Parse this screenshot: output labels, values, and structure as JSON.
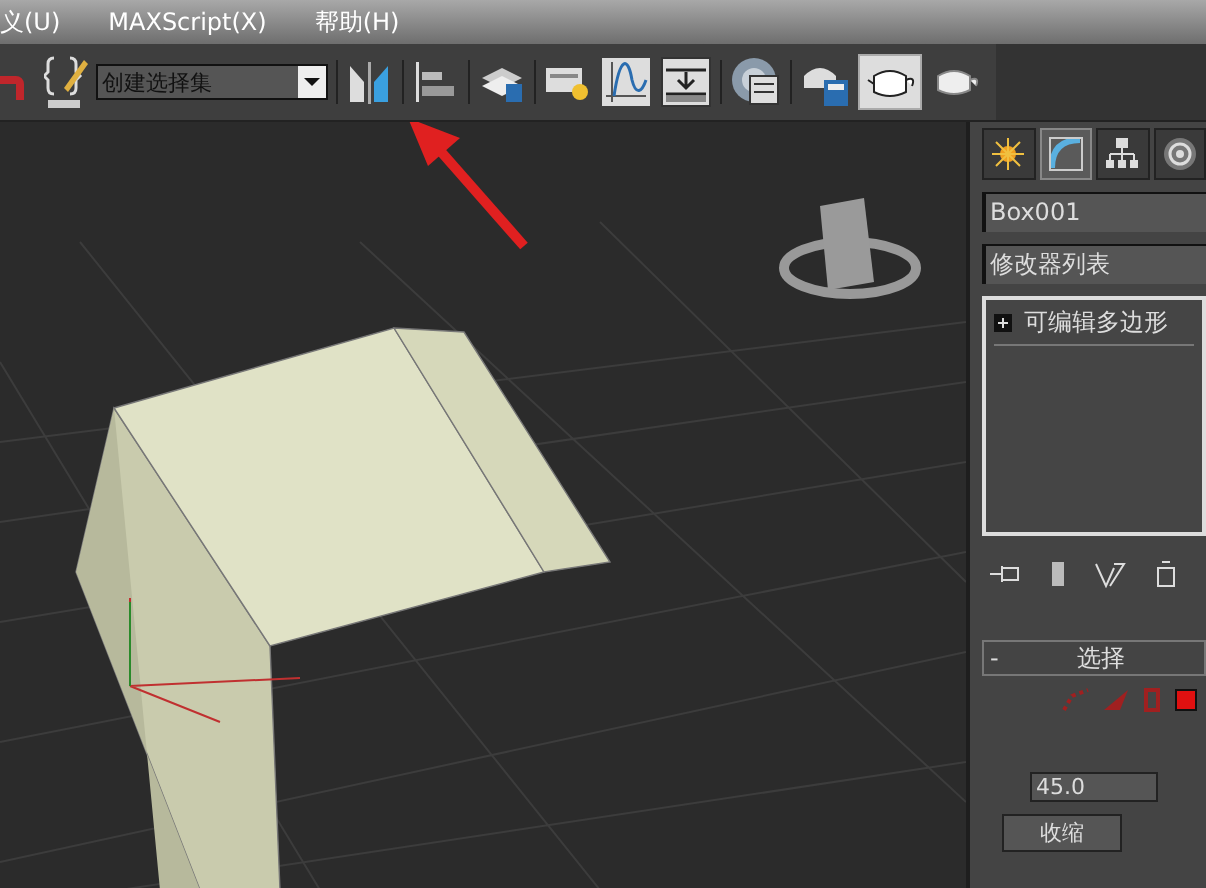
{
  "menu": [
    {
      "label": "义(U)"
    },
    {
      "label": "MAXScript(X)"
    },
    {
      "label": "帮助(H)"
    }
  ],
  "toolbar": {
    "selection_set": "创建选择集"
  },
  "command_panel": {
    "tabs": [
      {
        "kind": "create",
        "selected": false
      },
      {
        "kind": "modify",
        "selected": true
      },
      {
        "kind": "hierarchy",
        "selected": false
      },
      {
        "kind": "motion",
        "selected": false
      }
    ],
    "object_name": "Box001",
    "modifier_list": "修改器列表",
    "stack": [
      {
        "label": "可编辑多边形"
      }
    ],
    "rollout": {
      "collapse": "-",
      "title": "选择",
      "value": "45.0",
      "button": "收缩"
    }
  }
}
